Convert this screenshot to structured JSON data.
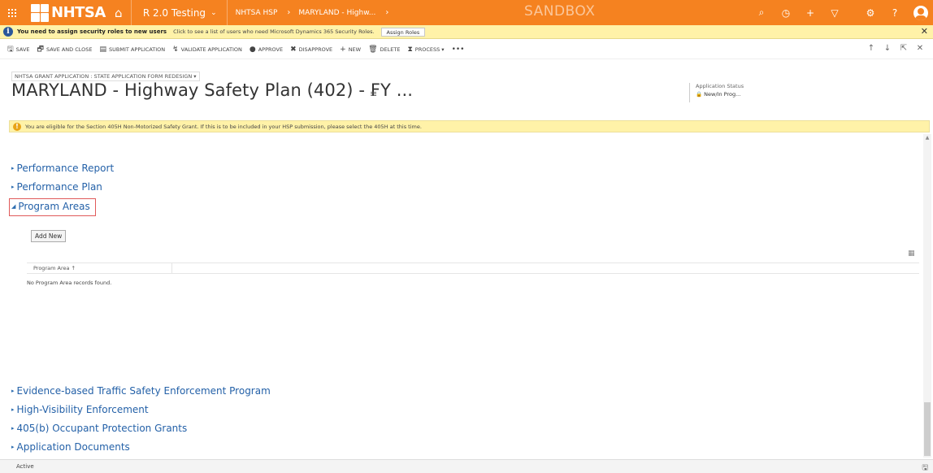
{
  "topbar": {
    "logo_text": "NHTSA",
    "environment": "R 2.0 Testing",
    "breadcrumbs": [
      "NHTSA HSP",
      "MARYLAND - Highw..."
    ],
    "sandbox_label": "SANDBOX"
  },
  "notification": {
    "bold_text": "You need to assign security roles to new users",
    "text": "Click to see a list of users who need Microsoft Dynamics 365 Security Roles.",
    "button_label": "Assign Roles",
    "close": "✕"
  },
  "commands": [
    {
      "icon": "save-icon",
      "glyph": "🖫",
      "label": "SAVE"
    },
    {
      "icon": "save-close-icon",
      "glyph": "🗗",
      "label": "SAVE AND CLOSE"
    },
    {
      "icon": "submit-icon",
      "glyph": "▤",
      "label": "SUBMIT APPLICATION"
    },
    {
      "icon": "validate-icon",
      "glyph": "↯",
      "label": "VALIDATE APPLICATION"
    },
    {
      "icon": "approve-icon",
      "glyph": "●",
      "label": "APPROVE"
    },
    {
      "icon": "disapprove-icon",
      "glyph": "✖",
      "label": "DISAPPROVE"
    },
    {
      "icon": "new-icon",
      "glyph": "+",
      "label": "NEW"
    },
    {
      "icon": "delete-icon",
      "glyph": "🗑",
      "label": "DELETE"
    },
    {
      "icon": "process-icon",
      "glyph": "⧗",
      "label": "PROCESS ▾"
    },
    {
      "icon": "more-icon",
      "glyph": "•••",
      "label": ""
    }
  ],
  "header": {
    "form_selector": "NHTSA GRANT APPLICATION : STATE APPLICATION FORM REDESIGN ▾",
    "title": "MARYLAND - Highway Safety Plan (402) - FY ...",
    "status_label": "Application Status",
    "status_value": "New/In Prog..."
  },
  "eligibility": {
    "text": "You are eligible for the Section 405H Non-Motorized Safety Grant. If this is to be included in your HSP submission, please select the 405H at this time."
  },
  "sections_top": [
    {
      "label": "Performance Report"
    },
    {
      "label": "Performance Plan"
    }
  ],
  "program_areas": {
    "label": "Program Areas",
    "add_new": "Add New",
    "column": "Program Area ↑",
    "empty": "No Program Area records found."
  },
  "sections_bottom": [
    {
      "label": "Evidence-based Traffic Safety Enforcement Program"
    },
    {
      "label": "High-Visibility Enforcement"
    },
    {
      "label": "405(b) Occupant Protection Grants"
    },
    {
      "label": "Application Documents"
    }
  ],
  "footer": {
    "status": "Active"
  },
  "colors": {
    "brand": "#f58220",
    "link": "#2461a8",
    "notice": "#fff2a8"
  }
}
